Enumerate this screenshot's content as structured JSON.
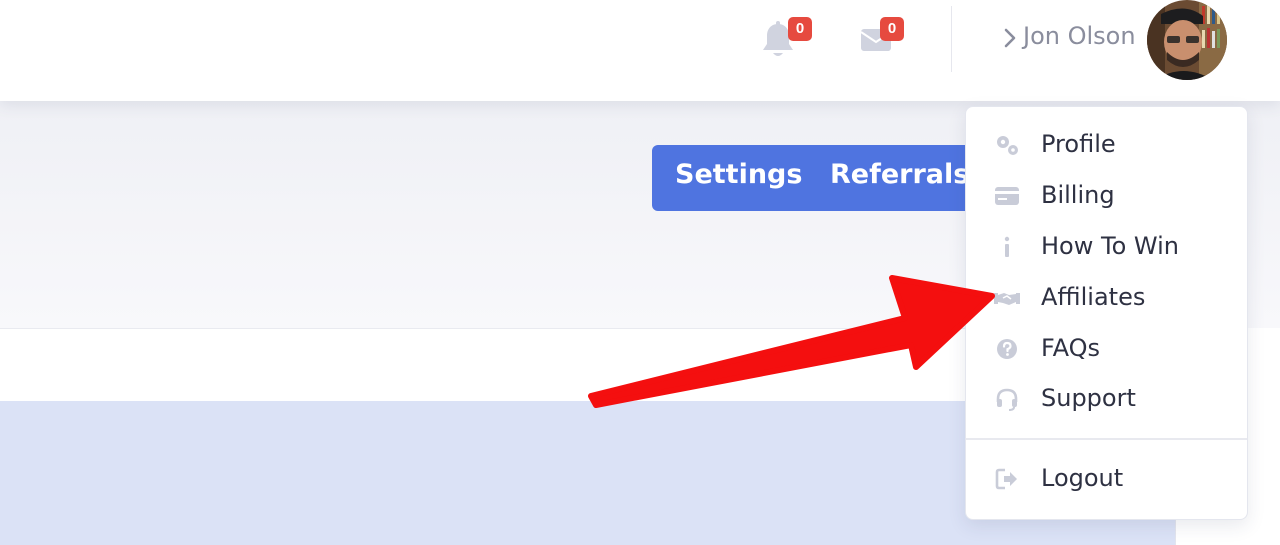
{
  "header": {
    "notifications": {
      "icon": "bell-icon",
      "count": "0"
    },
    "messages": {
      "icon": "envelope-icon",
      "count": "0"
    },
    "user": {
      "name": "Jon Olson",
      "chevron_icon": "chevron-right-icon"
    }
  },
  "tabs": [
    {
      "label": "Settings"
    },
    {
      "label": "Referrals"
    }
  ],
  "dropdown": {
    "items": [
      {
        "label": "Profile",
        "icon": "cogs-icon"
      },
      {
        "label": "Billing",
        "icon": "credit-card-icon"
      },
      {
        "label": "How To Win",
        "icon": "info-icon"
      },
      {
        "label": "Affiliates",
        "icon": "handshake-icon"
      },
      {
        "label": "FAQs",
        "icon": "question-circle-icon"
      },
      {
        "label": "Support",
        "icon": "headset-icon"
      }
    ],
    "logout": {
      "label": "Logout",
      "icon": "sign-out-icon"
    }
  },
  "annotation": {
    "icon": "red-arrow-icon",
    "points_to": "Affiliates"
  },
  "colors": {
    "accent_blue": "#4f74e0",
    "badge_red": "#e64a3f",
    "arrow_red": "#f40f0f",
    "panel_blue": "#dbe2f6",
    "icon_gray": "#c9ccd8"
  }
}
